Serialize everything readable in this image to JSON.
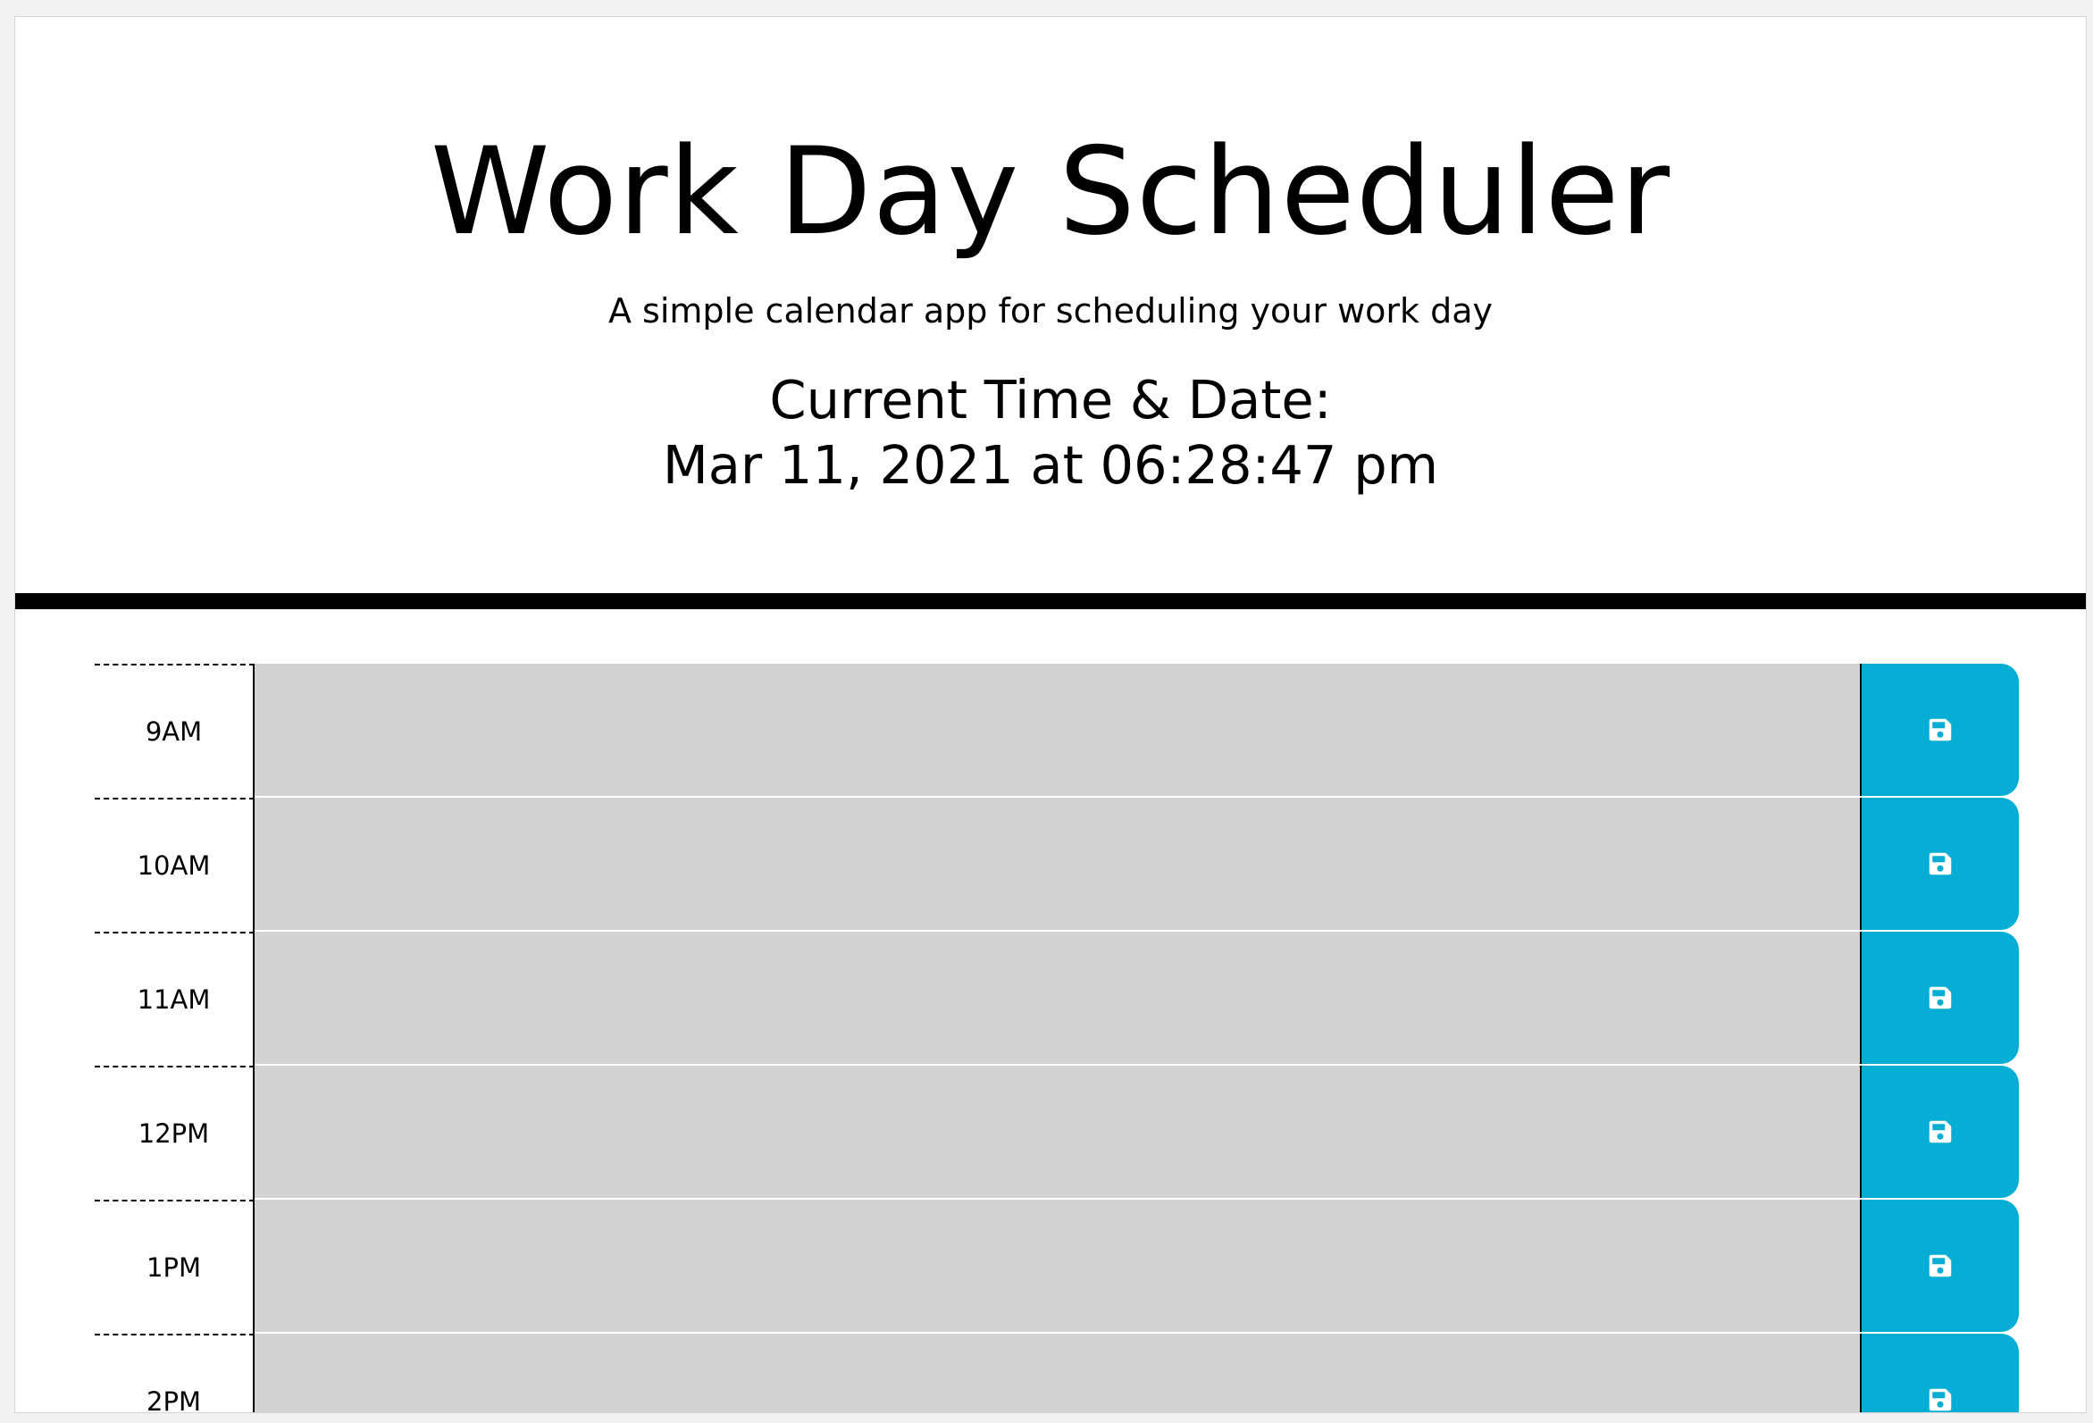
{
  "header": {
    "title": "Work Day Scheduler",
    "subtitle": "A simple calendar app for scheduling your work day",
    "time_label": "Current Time & Date:",
    "time_value": "Mar 11, 2021 at 06:28:47 pm"
  },
  "rows": [
    {
      "hour": "9AM",
      "task": ""
    },
    {
      "hour": "10AM",
      "task": ""
    },
    {
      "hour": "11AM",
      "task": ""
    },
    {
      "hour": "12PM",
      "task": ""
    },
    {
      "hour": "1PM",
      "task": ""
    },
    {
      "hour": "2PM",
      "task": ""
    }
  ],
  "icons": {
    "save": "save-icon"
  },
  "colors": {
    "save_button": "#06aed5",
    "task_past": "#d3d3d3",
    "divider": "#000000"
  }
}
